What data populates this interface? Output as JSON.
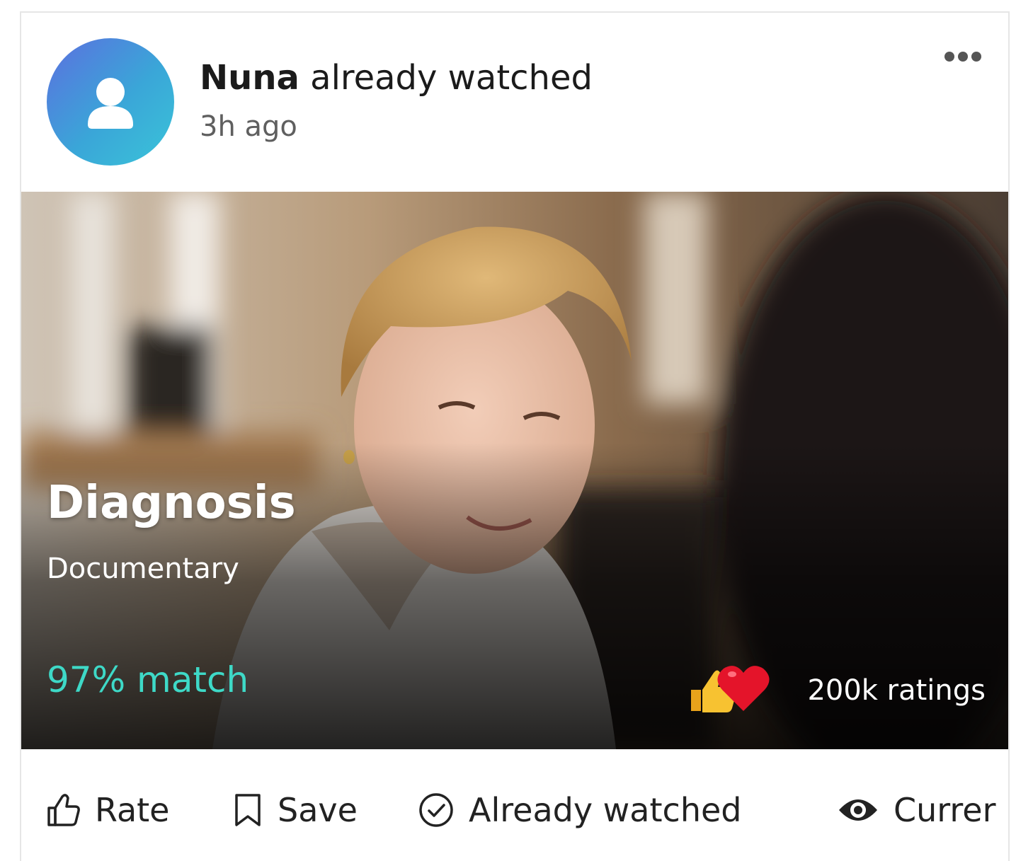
{
  "post": {
    "user_name": "Nuna",
    "action_text": " already watched",
    "timestamp": "3h ago"
  },
  "media": {
    "title": "Diagnosis",
    "genre": "Documentary",
    "match": "97% match",
    "ratings": "200k ratings",
    "reaction_icons": [
      "thumbs-up-icon",
      "heart-icon"
    ]
  },
  "actions": {
    "rate_label": "Rate",
    "save_label": "Save",
    "watched_label": "Already watched",
    "current_label": "Currer"
  },
  "colors": {
    "match": "#3ed9c7",
    "avatar_gradient_start": "#5c6fdf",
    "avatar_gradient_end": "#39c4d9"
  }
}
